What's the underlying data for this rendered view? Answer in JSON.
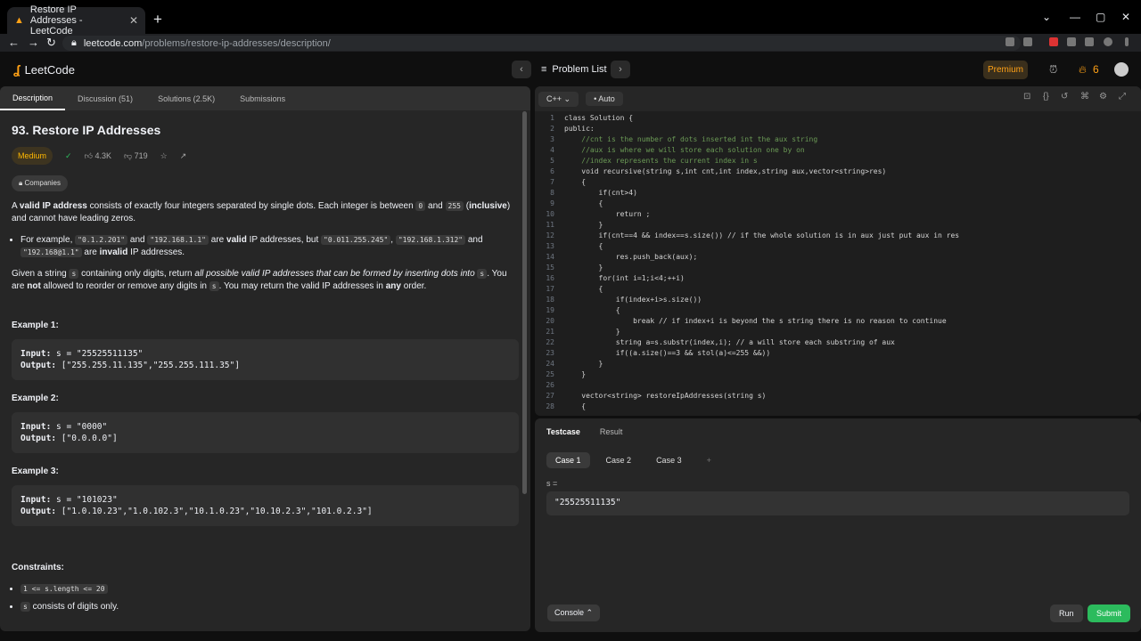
{
  "browser": {
    "tab_title": "Restore IP Addresses - LeetCode",
    "url_host": "leetcode.com",
    "url_path": "/problems/restore-ip-addresses/description/"
  },
  "header": {
    "logo": "LeetCode",
    "problem_list": "Problem List",
    "premium": "Premium",
    "streak": "6"
  },
  "left": {
    "tabs": [
      "Description",
      "Discussion (51)",
      "Solutions (2.5K)",
      "Submissions"
    ],
    "title": "93. Restore IP Addresses",
    "difficulty": "Medium",
    "likes": "4.3K",
    "dislikes": "719",
    "companies": "Companies",
    "p1a": "A ",
    "p1b": "valid IP address",
    "p1c": " consists of exactly four integers separated by single dots. Each integer is between ",
    "p1d": "0",
    "p1e": " and ",
    "p1f": "255",
    "p1g": " (",
    "p1h": "inclusive",
    "p1i": ") and cannot have leading zeros.",
    "b1a": "For example, ",
    "b1b": "\"0.1.2.201\"",
    "b1c": " and ",
    "b1d": "\"192.168.1.1\"",
    "b1e": " are ",
    "b1f": "valid",
    "b1g": " IP addresses, but ",
    "b1h": "\"0.011.255.245\"",
    "b1i": ", ",
    "b1j": "\"192.168.1.312\"",
    "b1k": " and ",
    "b1l": "\"192.168@1.1\"",
    "b1m": " are ",
    "b1n": "invalid",
    "b1o": " IP addresses.",
    "p2a": "Given a string ",
    "p2b": "s",
    "p2c": " containing only digits, return ",
    "p2d": "all possible valid IP addresses that can be formed by inserting dots into ",
    "p2e": "s",
    "p2f": ". You are ",
    "p2g": "not",
    "p2h": " allowed to reorder or remove any digits in ",
    "p2i": "s",
    "p2j": ". You may return the valid IP addresses in ",
    "p2k": "any",
    "p2l": " order.",
    "ex1h": "Example 1:",
    "ex1i": "Input:",
    "ex1iv": " s = \"25525511135\"",
    "ex1o": "Output:",
    "ex1ov": " [\"255.255.11.135\",\"255.255.111.35\"]",
    "ex2h": "Example 2:",
    "ex2i": "Input:",
    "ex2iv": " s = \"0000\"",
    "ex2o": "Output:",
    "ex2ov": " [\"0.0.0.0\"]",
    "ex3h": "Example 3:",
    "ex3i": "Input:",
    "ex3iv": " s = \"101023\"",
    "ex3o": "Output:",
    "ex3ov": " [\"1.0.10.23\",\"1.0.102.3\",\"10.1.0.23\",\"10.10.2.3\",\"101.0.2.3\"]",
    "ch": "Constraints:",
    "c1": "1 <= s.length <= 20",
    "c2a": "s",
    "c2b": " consists of digits only."
  },
  "editor": {
    "lang": "C++",
    "auto": "Auto",
    "lines": [
      "class Solution {",
      "public:",
      "    //cnt is the number of dots inserted int the aux string",
      "    //aux is where we will store each solution one by on",
      "    //index represents the current index in s",
      "    void recursive(string s,int cnt,int index,string aux,vector<string>res)",
      "    {",
      "        if(cnt>4)",
      "        {",
      "            return ;",
      "        }",
      "        if(cnt==4 && index==s.size()) // if the whole solution is in aux just put aux in res",
      "        {",
      "            res.push_back(aux);",
      "        }",
      "        for(int i=1;i<4;++i)",
      "        {",
      "            if(index+i>s.size())",
      "            {",
      "                break // if index+i is beyond the s string there is no reason to continue",
      "            }",
      "            string a=s.substr(index,i); // a will store each substring of aux",
      "            if((a.size()==3 && stol(a)<=255 &&))",
      "        }",
      "    }",
      "",
      "    vector<string> restoreIpAddresses(string s)",
      "    {"
    ]
  },
  "bottom": {
    "tabs": [
      "Testcase",
      "Result"
    ],
    "cases": [
      "Case 1",
      "Case 2",
      "Case 3"
    ],
    "plus": "+",
    "s_label": "s =",
    "s_value": "\"25525511135\"",
    "console": "Console",
    "run": "Run",
    "submit": "Submit"
  }
}
